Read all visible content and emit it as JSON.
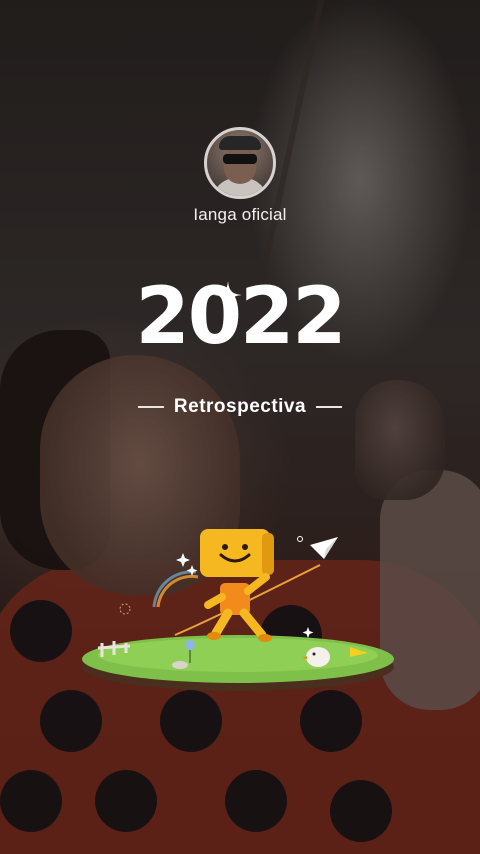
{
  "profile": {
    "username": "Ianga oficial",
    "avatar_icon": "avatar-photo"
  },
  "hero": {
    "year": "2022",
    "subtitle": "Retrospectiva"
  },
  "colors": {
    "text": "#ffffff",
    "grass": "#7ec04a",
    "mascot": "#f5b820"
  },
  "illustration": {
    "mascot_icon": "smiley-box-mascot",
    "plane_icon": "paper-plane-icon",
    "sparkle_icon": "sparkle-icon"
  }
}
